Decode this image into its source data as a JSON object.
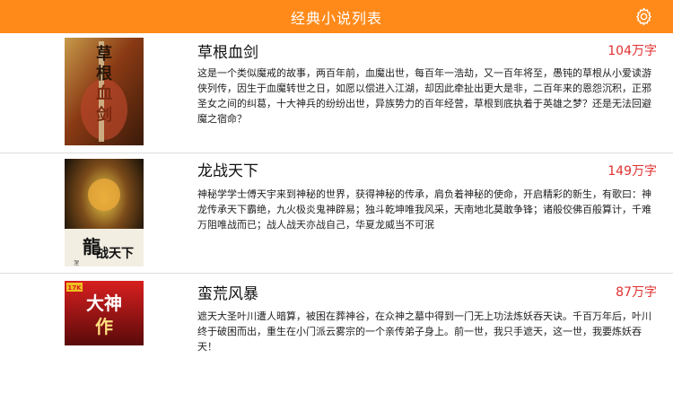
{
  "navbar": {
    "title": "经典小说列表",
    "settings_icon": "gear-icon",
    "background": "#ff8a1a"
  },
  "accent": {
    "count_color": "#e03030"
  },
  "books": [
    {
      "title": "草根血剑",
      "count": "104万字",
      "description": "这是一个类似魔戒的故事，两百年前，血魔出世，每百年一浩劫，又一百年将至，愚钝的草根从小爱读游侠列传，因生于血魔转世之日，如愿以偿进入江湖，却因此牵扯出更大是非，二百年来的恩怨沉积，正邪圣女之间的纠葛，十大神兵的纷纷出世，异族势力的百年经营，草根到底执着于英雄之梦？还是无法回避魔之宿命？",
      "cover_text": "草根血剑"
    },
    {
      "title": "龙战天下",
      "count": "149万字",
      "description": "神秘学学士傅天宇来到神秘的世界，获得神秘的传承，肩负着神秘的使命，开启精彩的新生，有歌曰：神龙传承天下霸绝，九火极炎鬼神辟易；独斗乾坤唯我风采，天南地北莫敢争锋；诸般佼佛百般算计，千难万阻唯战而已；战人战天亦战自己，华夏龙威当不可泯",
      "cover_text": "龍战天下"
    },
    {
      "title": "蛮荒风暴",
      "count": "87万字",
      "description": "遮天大圣叶川遭人暗算，被困在葬神谷，在众神之墓中得到一门无上功法炼妖吞天诀。千百万年后，叶川终于破困而出，重生在小门派云雾宗的一个亲传弟子身上。前一世，我只手遮天，这一世，我要炼妖吞天！",
      "cover_text": "大神作"
    }
  ]
}
